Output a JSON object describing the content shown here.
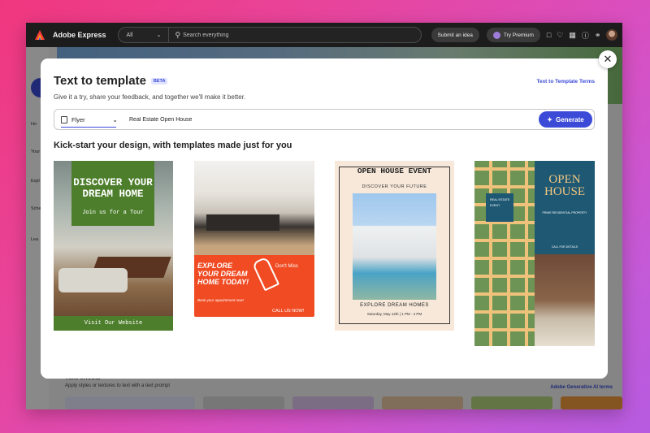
{
  "app": {
    "name": "Adobe Express"
  },
  "topbar": {
    "scope": "All",
    "search_placeholder": "Search everything",
    "submit_idea": "Submit an idea",
    "try_premium": "Try Premium"
  },
  "sidebar": {
    "items": [
      "Ho",
      "Your",
      "Expl",
      "Sche",
      "Lea"
    ]
  },
  "background": {
    "section_title": "Text effects",
    "section_subtitle": "Apply styles or textures to text with a text prompt",
    "terms_link": "Adobe Generative AI terms"
  },
  "modal": {
    "title": "Text to template",
    "badge": "BETA",
    "terms_link": "Text to Template Terms",
    "subtitle": "Give it a try, share your feedback, and together we'll make it better.",
    "type_selected": "Flyer",
    "prompt_value": "Real Estate Open House",
    "generate_label": "Generate",
    "section_heading": "Kick-start your design, with templates made just for you"
  },
  "templates": [
    {
      "heading": "DISCOVER YOUR DREAM HOME",
      "sub": "Join us for a Tour",
      "footer": "Visit Our Website"
    },
    {
      "heading": "EXPLORE YOUR DREAM HOME TODAY!",
      "tag": "Don't Miss",
      "sub": "Book your appointment now!",
      "footer": "CALL US NOW!"
    },
    {
      "heading": "OPEN HOUSE EVENT",
      "sub": "DISCOVER YOUR FUTURE",
      "cta": "EXPLORE DREAM HOMES",
      "date": "Saturday, May 12th | 1 PM - 4 PM"
    },
    {
      "heading": "OPEN HOUSE",
      "label_lines": "REAL ESTATE EVENT",
      "sub": "PRIME RESIDENTIAL PROPERTY",
      "footer": "CALL FOR DETAILS"
    }
  ]
}
